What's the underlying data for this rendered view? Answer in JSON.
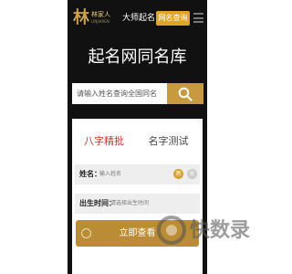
{
  "header": {
    "logo_mark": "林",
    "logo_name": "林家人",
    "logo_sub": "LINJIAREN",
    "nav_link": "大师起名",
    "nav_pill": "网名查询"
  },
  "hero": {
    "title": "起名网同名库"
  },
  "search": {
    "placeholder": "请输入姓名查询全国同名"
  },
  "tabs": [
    {
      "label": "八字精批",
      "active": true
    },
    {
      "label": "名字测试",
      "active": false
    }
  ],
  "form": {
    "name_label": "姓名：",
    "name_placeholder": "输入姓名",
    "gender_male": "男",
    "gender_female": "女",
    "time_label": "出生时间：",
    "time_placeholder": "请选择出生时间",
    "submit_label": "立即查看"
  },
  "watermark": {
    "text": "快数录"
  },
  "colors": {
    "background": "#111111",
    "accent": "#e1a526",
    "button": "#b98c35",
    "tab_active": "#c0392b"
  }
}
